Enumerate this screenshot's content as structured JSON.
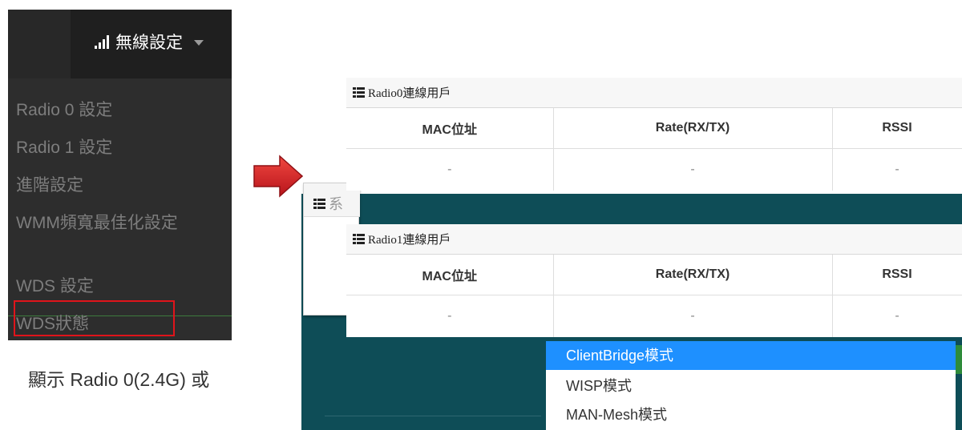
{
  "menu": {
    "title": "無線設定",
    "items": [
      "Radio 0 設定",
      "Radio 1 設定",
      "進階設定",
      "WMM頻寬最佳化設定"
    ],
    "items2": [
      "WDS 設定",
      "WDS狀態"
    ]
  },
  "dialog": {
    "title_fragment": "系"
  },
  "tables": [
    {
      "title": "Radio0連線用戶",
      "columns": [
        "MAC位址",
        "Rate(RX/TX)",
        "RSSI"
      ],
      "row": [
        "-",
        "-",
        "-"
      ]
    },
    {
      "title": "Radio1連線用戶",
      "columns": [
        "MAC位址",
        "Rate(RX/TX)",
        "RSSI"
      ],
      "row": [
        "-",
        "-",
        "-"
      ]
    }
  ],
  "dropdown": {
    "options": [
      "ClientBridge模式",
      "WISP模式",
      "MAN-Mesh模式"
    ],
    "selected": "ClientBridge模式"
  },
  "caption": "顯示 Radio 0(2.4G)  或",
  "colors": {
    "highlight_border": "#e0141b",
    "selected_option": "#1e90ff",
    "arrow": "#d9232b",
    "panel_bg": "#0e4d57"
  }
}
